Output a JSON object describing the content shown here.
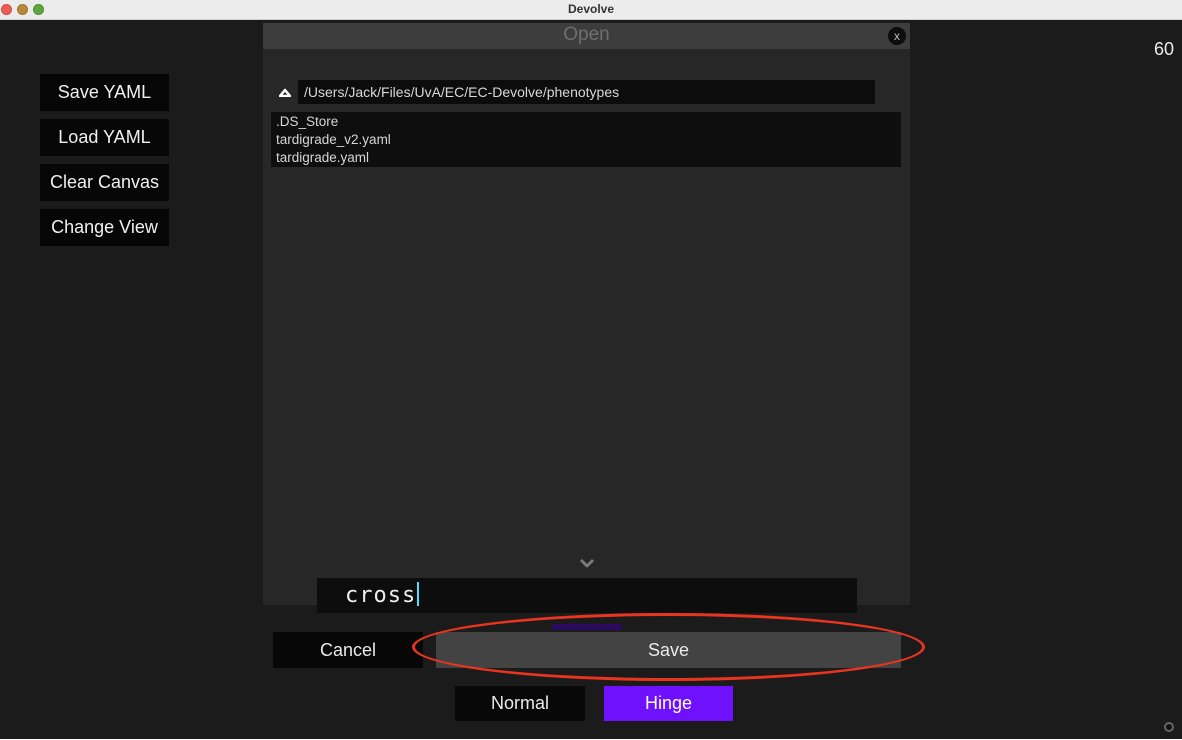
{
  "window": {
    "title": "Devolve"
  },
  "fps": "60",
  "sidebar": {
    "buttons": [
      {
        "label": "Save YAML"
      },
      {
        "label": "Load YAML"
      },
      {
        "label": "Clear Canvas"
      },
      {
        "label": "Change View"
      }
    ]
  },
  "dialog": {
    "title": "Open",
    "close_label": "x",
    "path": "/Users/Jack/Files/UvA/EC/EC-Devolve/phenotypes",
    "files": [
      ".DS_Store",
      "tardigrade_v2.yaml",
      "tardigrade.yaml"
    ],
    "filename": "cross",
    "cancel_label": "Cancel",
    "save_label": "Save"
  },
  "modes": {
    "normal_label": "Normal",
    "hinge_label": "Hinge",
    "active": "Hinge",
    "active_color": "#6f10ff"
  },
  "icons": {
    "up": "up-arrow-icon",
    "scroll_more": "chevron-down-icon",
    "corner": "resize-grip-icon"
  }
}
